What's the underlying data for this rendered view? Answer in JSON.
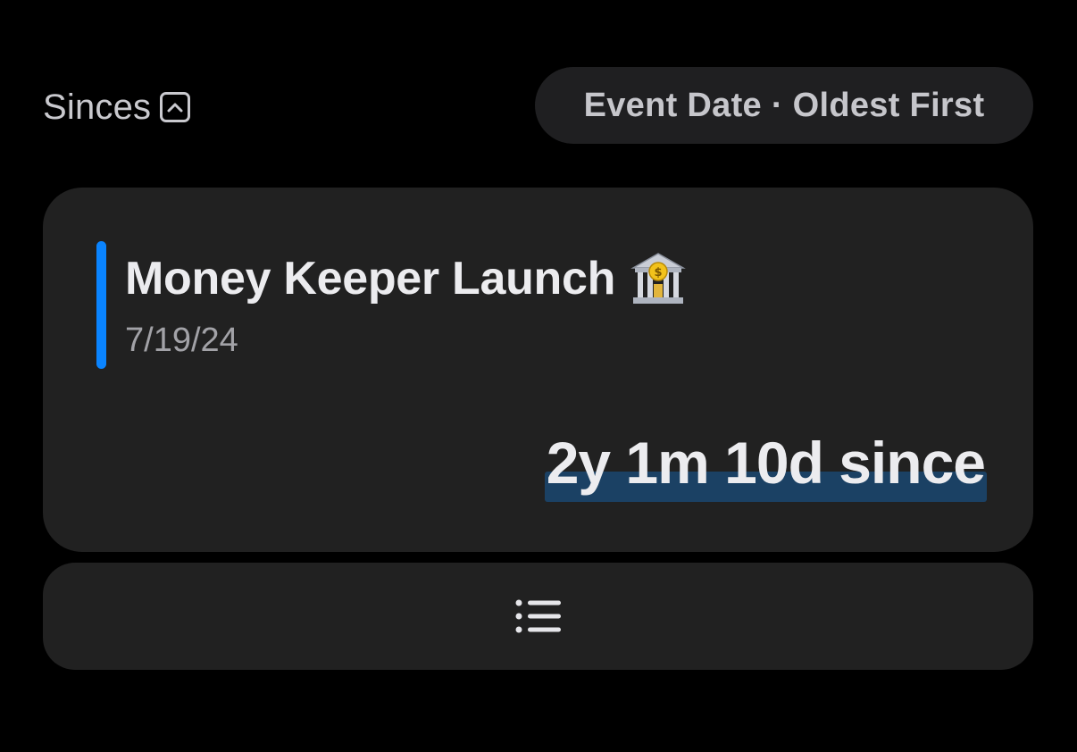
{
  "header": {
    "title": "Sinces",
    "collapse_icon": "chevron-up-square-icon"
  },
  "sort": {
    "label": "Event Date · Oldest First"
  },
  "event": {
    "name": "Money Keeper Launch",
    "emoji_icon": "bank-building-icon",
    "date": "7/19/24",
    "elapsed": "2y 1m 10d since",
    "accent_color": "#0a84ff",
    "highlight_color": "#1b4164"
  },
  "footer": {
    "icon": "list-bullet-icon"
  }
}
